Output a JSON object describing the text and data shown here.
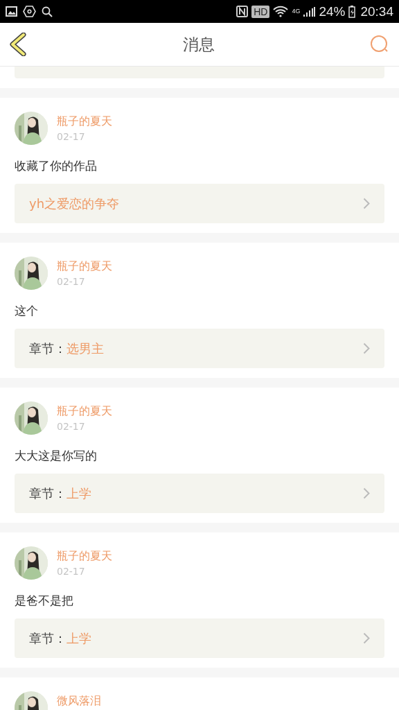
{
  "status_bar": {
    "hd": "HD",
    "network": "4G",
    "battery": "24%",
    "time": "20:34"
  },
  "header": {
    "title": "消息"
  },
  "messages": [
    {
      "user": "瓶子的夏天",
      "date": "02-17",
      "text": "收藏了你的作品",
      "link": {
        "kind": "work",
        "title": "yh之爱恋的争夺"
      }
    },
    {
      "user": "瓶子的夏天",
      "date": "02-17",
      "text": "这个",
      "link": {
        "kind": "chapter",
        "label": "章节：",
        "title": "选男主"
      }
    },
    {
      "user": "瓶子的夏天",
      "date": "02-17",
      "text": "大大这是你写的",
      "link": {
        "kind": "chapter",
        "label": "章节：",
        "title": "上学"
      }
    },
    {
      "user": "瓶子的夏天",
      "date": "02-17",
      "text": "是爸不是把",
      "link": {
        "kind": "chapter",
        "label": "章节：",
        "title": "上学"
      }
    },
    {
      "user": "微风落泪"
    }
  ]
}
